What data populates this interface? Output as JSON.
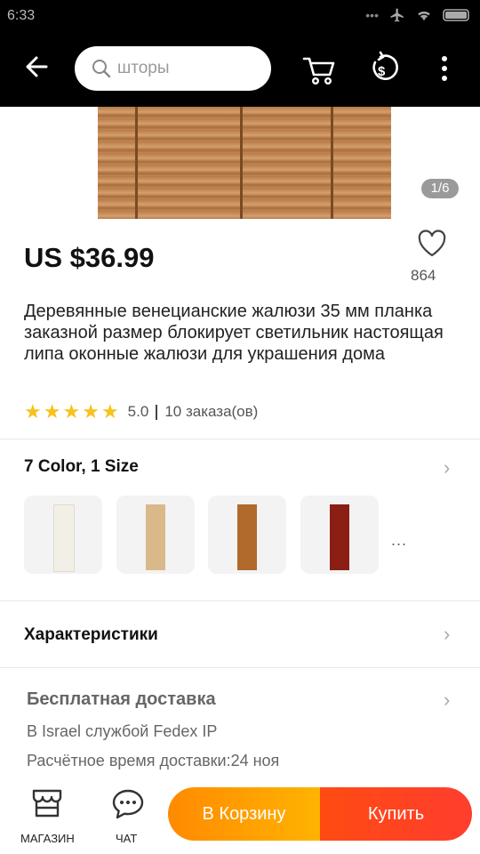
{
  "status": {
    "time": "6:33"
  },
  "search": {
    "placeholder": "шторы"
  },
  "gallery": {
    "pager": "1/6"
  },
  "product": {
    "price": "US $36.99",
    "favorites": "864",
    "title": "Деревянные венецианские жалюзи 35 мм планка заказной размер блокирует светильник настоящая липа оконные жалюзи для украшения дома",
    "rating": "5.0",
    "orders": "10 заказа(ов)"
  },
  "variants": {
    "title": "7 Color, 1 Size",
    "swatches": [
      {
        "color": "#f2efe6"
      },
      {
        "color": "#d9b98a"
      },
      {
        "color": "#b06a2b"
      },
      {
        "color": "#8b1f14"
      }
    ],
    "more": "..."
  },
  "specs": {
    "title": "Характеристики"
  },
  "shipping": {
    "title": "Бесплатная доставка",
    "line1": "В Israel службой Fedex IP",
    "line2": "Расчётное время доставки:24 ноя"
  },
  "bottom": {
    "store_label": "МАГАЗИН",
    "chat_label": "ЧАТ",
    "add_to_cart": "В Корзину",
    "buy": "Купить"
  },
  "colors": {
    "accent_orange": "#ff9900",
    "accent_red": "#ff4b12",
    "star": "#f7c21b"
  }
}
